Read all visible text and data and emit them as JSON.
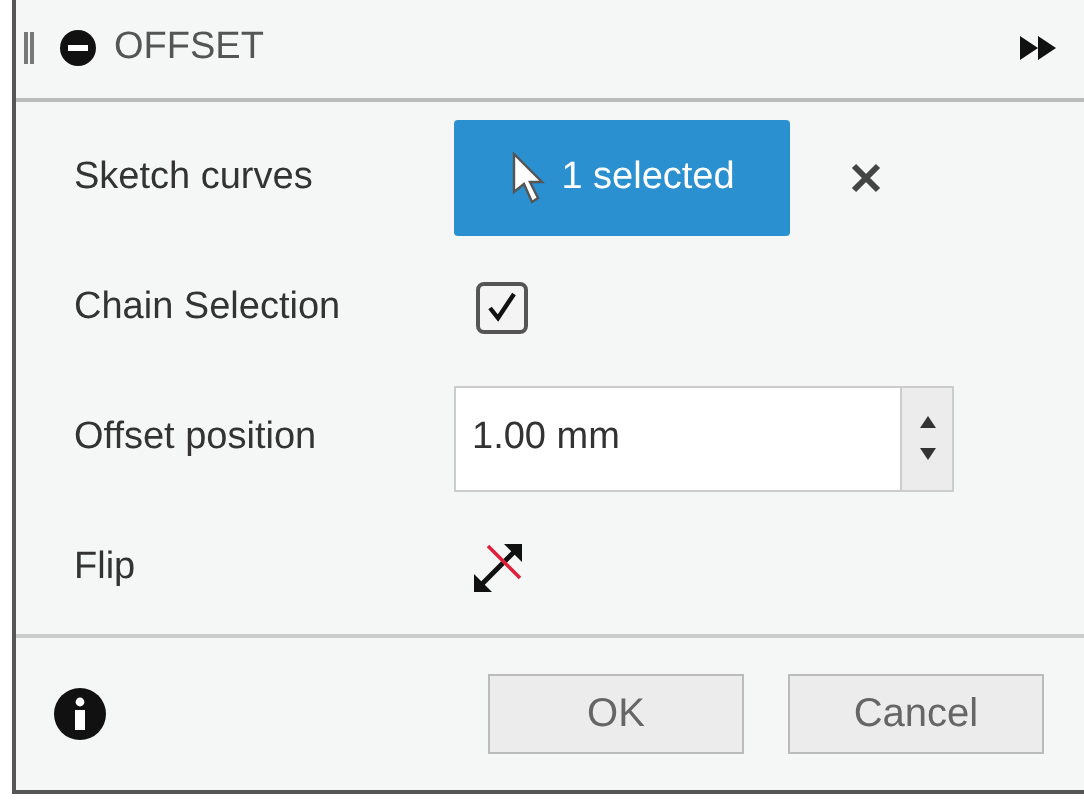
{
  "panel": {
    "title": "OFFSET"
  },
  "rows": [
    {
      "kind": "selection",
      "label": "Sketch curves",
      "value": "1 selected"
    },
    {
      "kind": "checkbox",
      "label": "Chain Selection",
      "checked": true
    },
    {
      "kind": "number",
      "label": "Offset position",
      "value": "1.00 mm"
    },
    {
      "kind": "flip",
      "label": "Flip"
    }
  ],
  "buttons": [
    "OK",
    "Cancel"
  ]
}
